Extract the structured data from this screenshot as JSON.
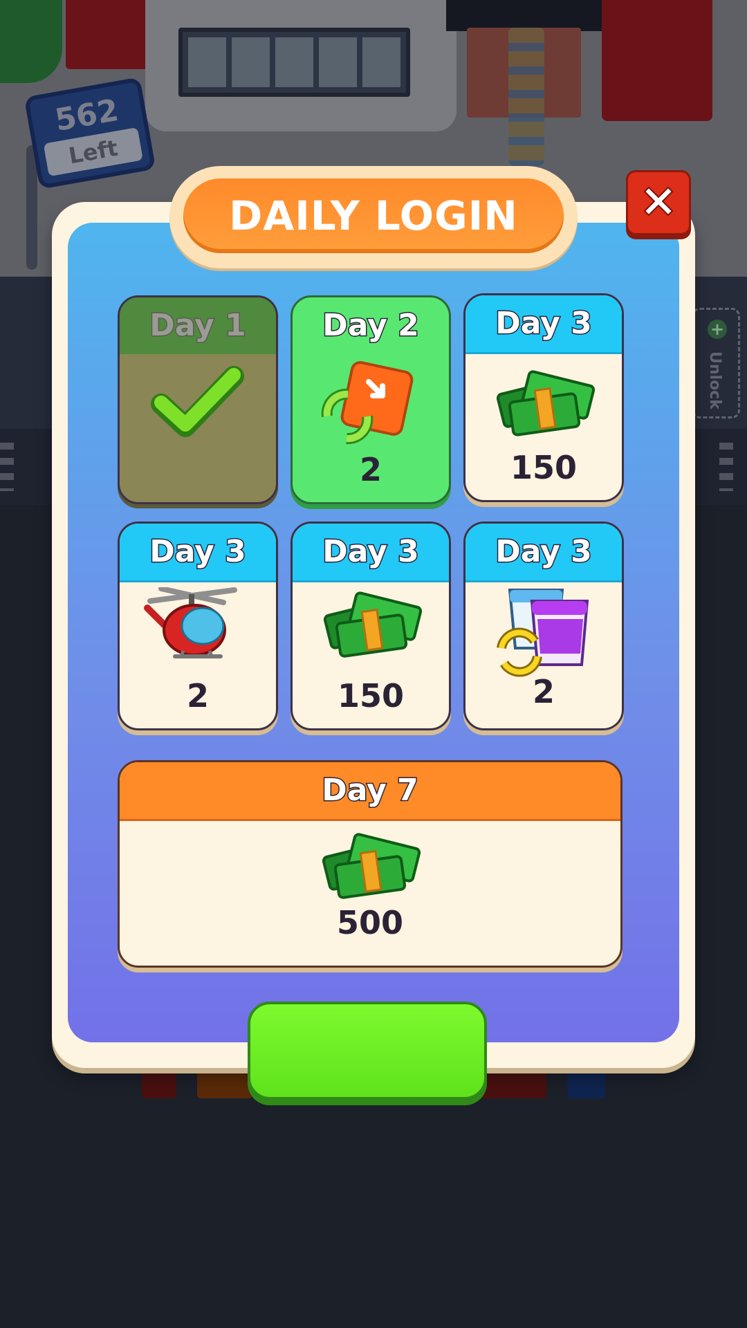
{
  "background": {
    "sign_count": "562",
    "sign_label": "Left",
    "unlock_label": "Unlock"
  },
  "dialog": {
    "title": "DAILY LOGIN",
    "close_icon": "close-x-icon",
    "days": [
      {
        "label": "Day 1",
        "state": "claimed",
        "icon": "checkmark-icon",
        "amount": ""
      },
      {
        "label": "Day 2",
        "state": "today",
        "icon": "shuffle-box-icon",
        "amount": "2"
      },
      {
        "label": "Day 3",
        "state": "locked",
        "icon": "cash-stack-icon",
        "amount": "150"
      },
      {
        "label": "Day 3",
        "state": "locked",
        "icon": "helicopter-icon",
        "amount": "2"
      },
      {
        "label": "Day 3",
        "state": "locked",
        "icon": "cash-stack-icon",
        "amount": "150"
      },
      {
        "label": "Day 3",
        "state": "locked",
        "icon": "cup-swap-icon",
        "amount": "2"
      }
    ],
    "grand_prize": {
      "label": "Day 7",
      "icon": "cash-stack-icon",
      "amount": "500"
    },
    "claim_button_label": ""
  },
  "colors": {
    "accent_orange": "#ff8a2a",
    "card_header_blue": "#22c9f7",
    "today_green": "#58e872",
    "claimed_olive": "#8a8656",
    "claim_green": "#6cf024",
    "close_red": "#dc2e18"
  }
}
